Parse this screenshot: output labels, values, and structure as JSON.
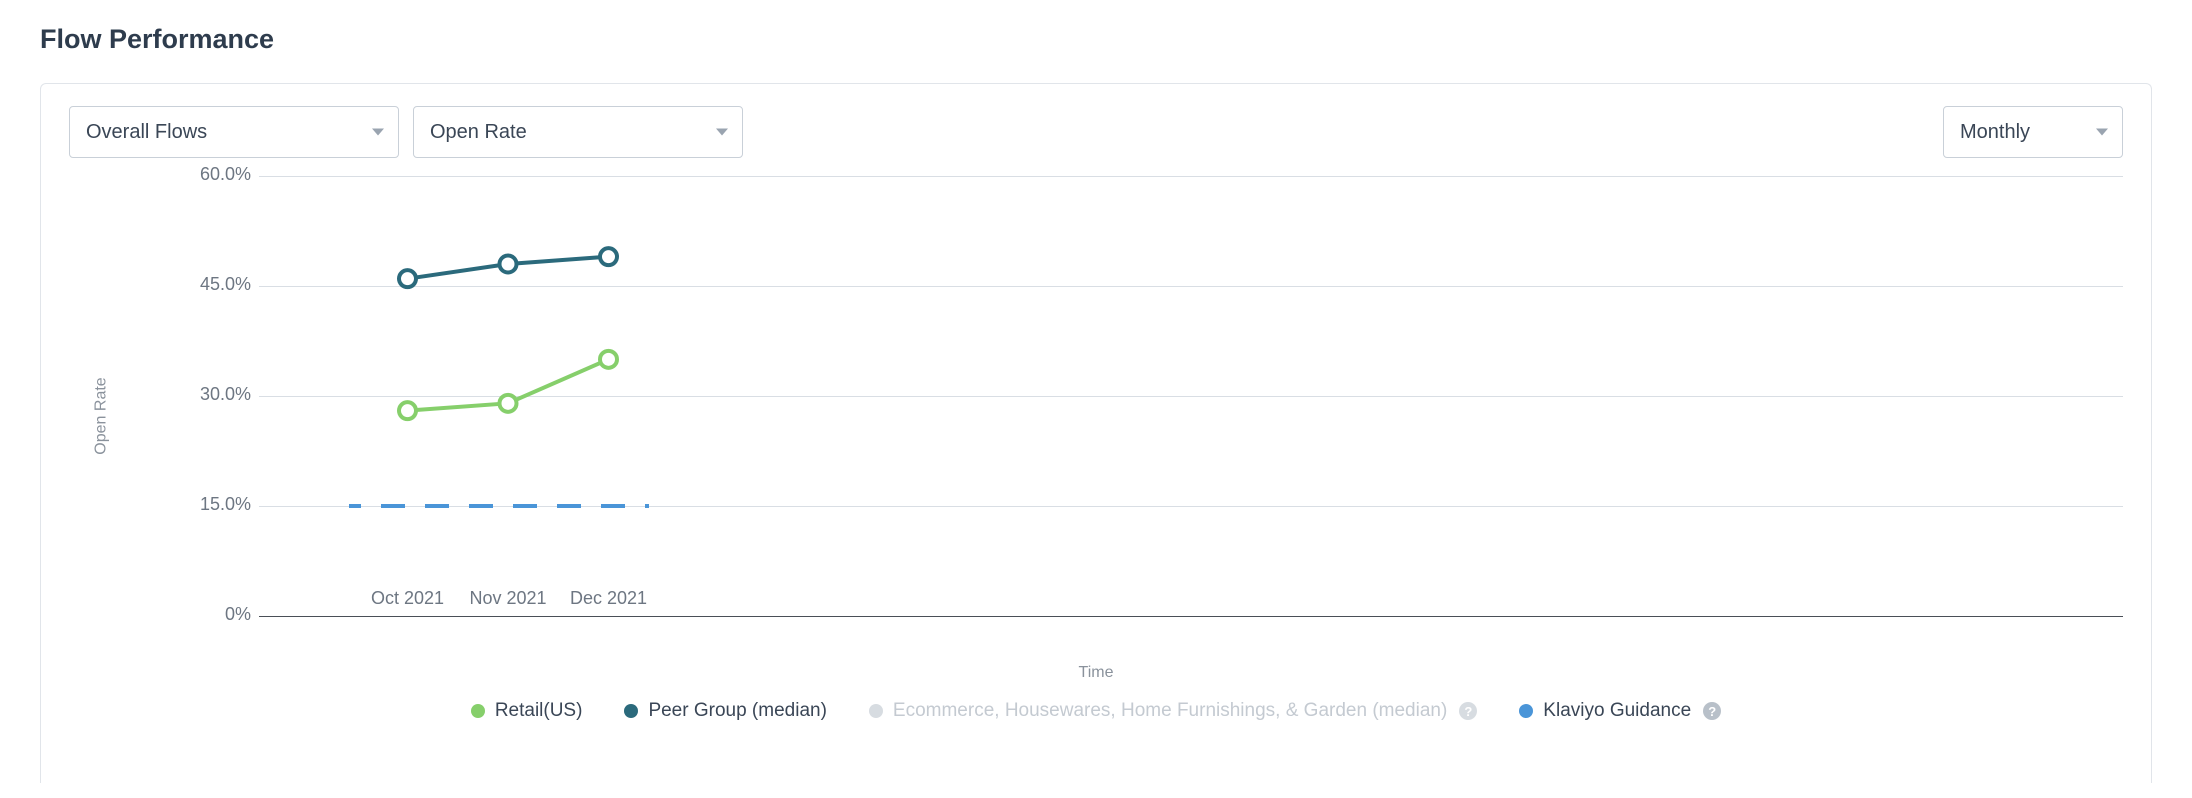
{
  "section_title": "Flow Performance",
  "toolbar": {
    "flow_select": "Overall Flows",
    "metric_select": "Open Rate",
    "interval_select": "Monthly"
  },
  "legend": {
    "retail": "Retail(US)",
    "peer": "Peer Group (median)",
    "muted": "Ecommerce, Housewares, Home Furnishings, & Garden (median)",
    "guidance": "Klaviyo Guidance"
  },
  "axis": {
    "ylabel": "Open Rate",
    "xlabel": "Time",
    "yticks": [
      "0%",
      "15.0%",
      "30.0%",
      "45.0%",
      "60.0%"
    ]
  },
  "chart_data": {
    "type": "line",
    "xlabel": "Time",
    "ylabel": "Open Rate",
    "ylim": [
      0,
      60
    ],
    "yticks": [
      0,
      15,
      30,
      45,
      60
    ],
    "categories": [
      "Oct 2021",
      "Nov 2021",
      "Dec 2021"
    ],
    "guidance_value": 15.0,
    "series": [
      {
        "name": "Retail(US)",
        "color": "#86cf6b",
        "values": [
          28.0,
          29.0,
          35.0
        ]
      },
      {
        "name": "Peer Group (median)",
        "color": "#2b6a7c",
        "values": [
          46.0,
          48.0,
          49.0
        ]
      },
      {
        "name": "Ecommerce, Housewares, Home Furnishings, & Garden (median)",
        "color": "#c9d0d8",
        "values": null,
        "hidden": true
      },
      {
        "name": "Klaviyo Guidance",
        "color": "#4a95d8",
        "values": [
          15.0,
          15.0,
          15.0
        ],
        "style": "dashed",
        "markers": false
      }
    ]
  }
}
